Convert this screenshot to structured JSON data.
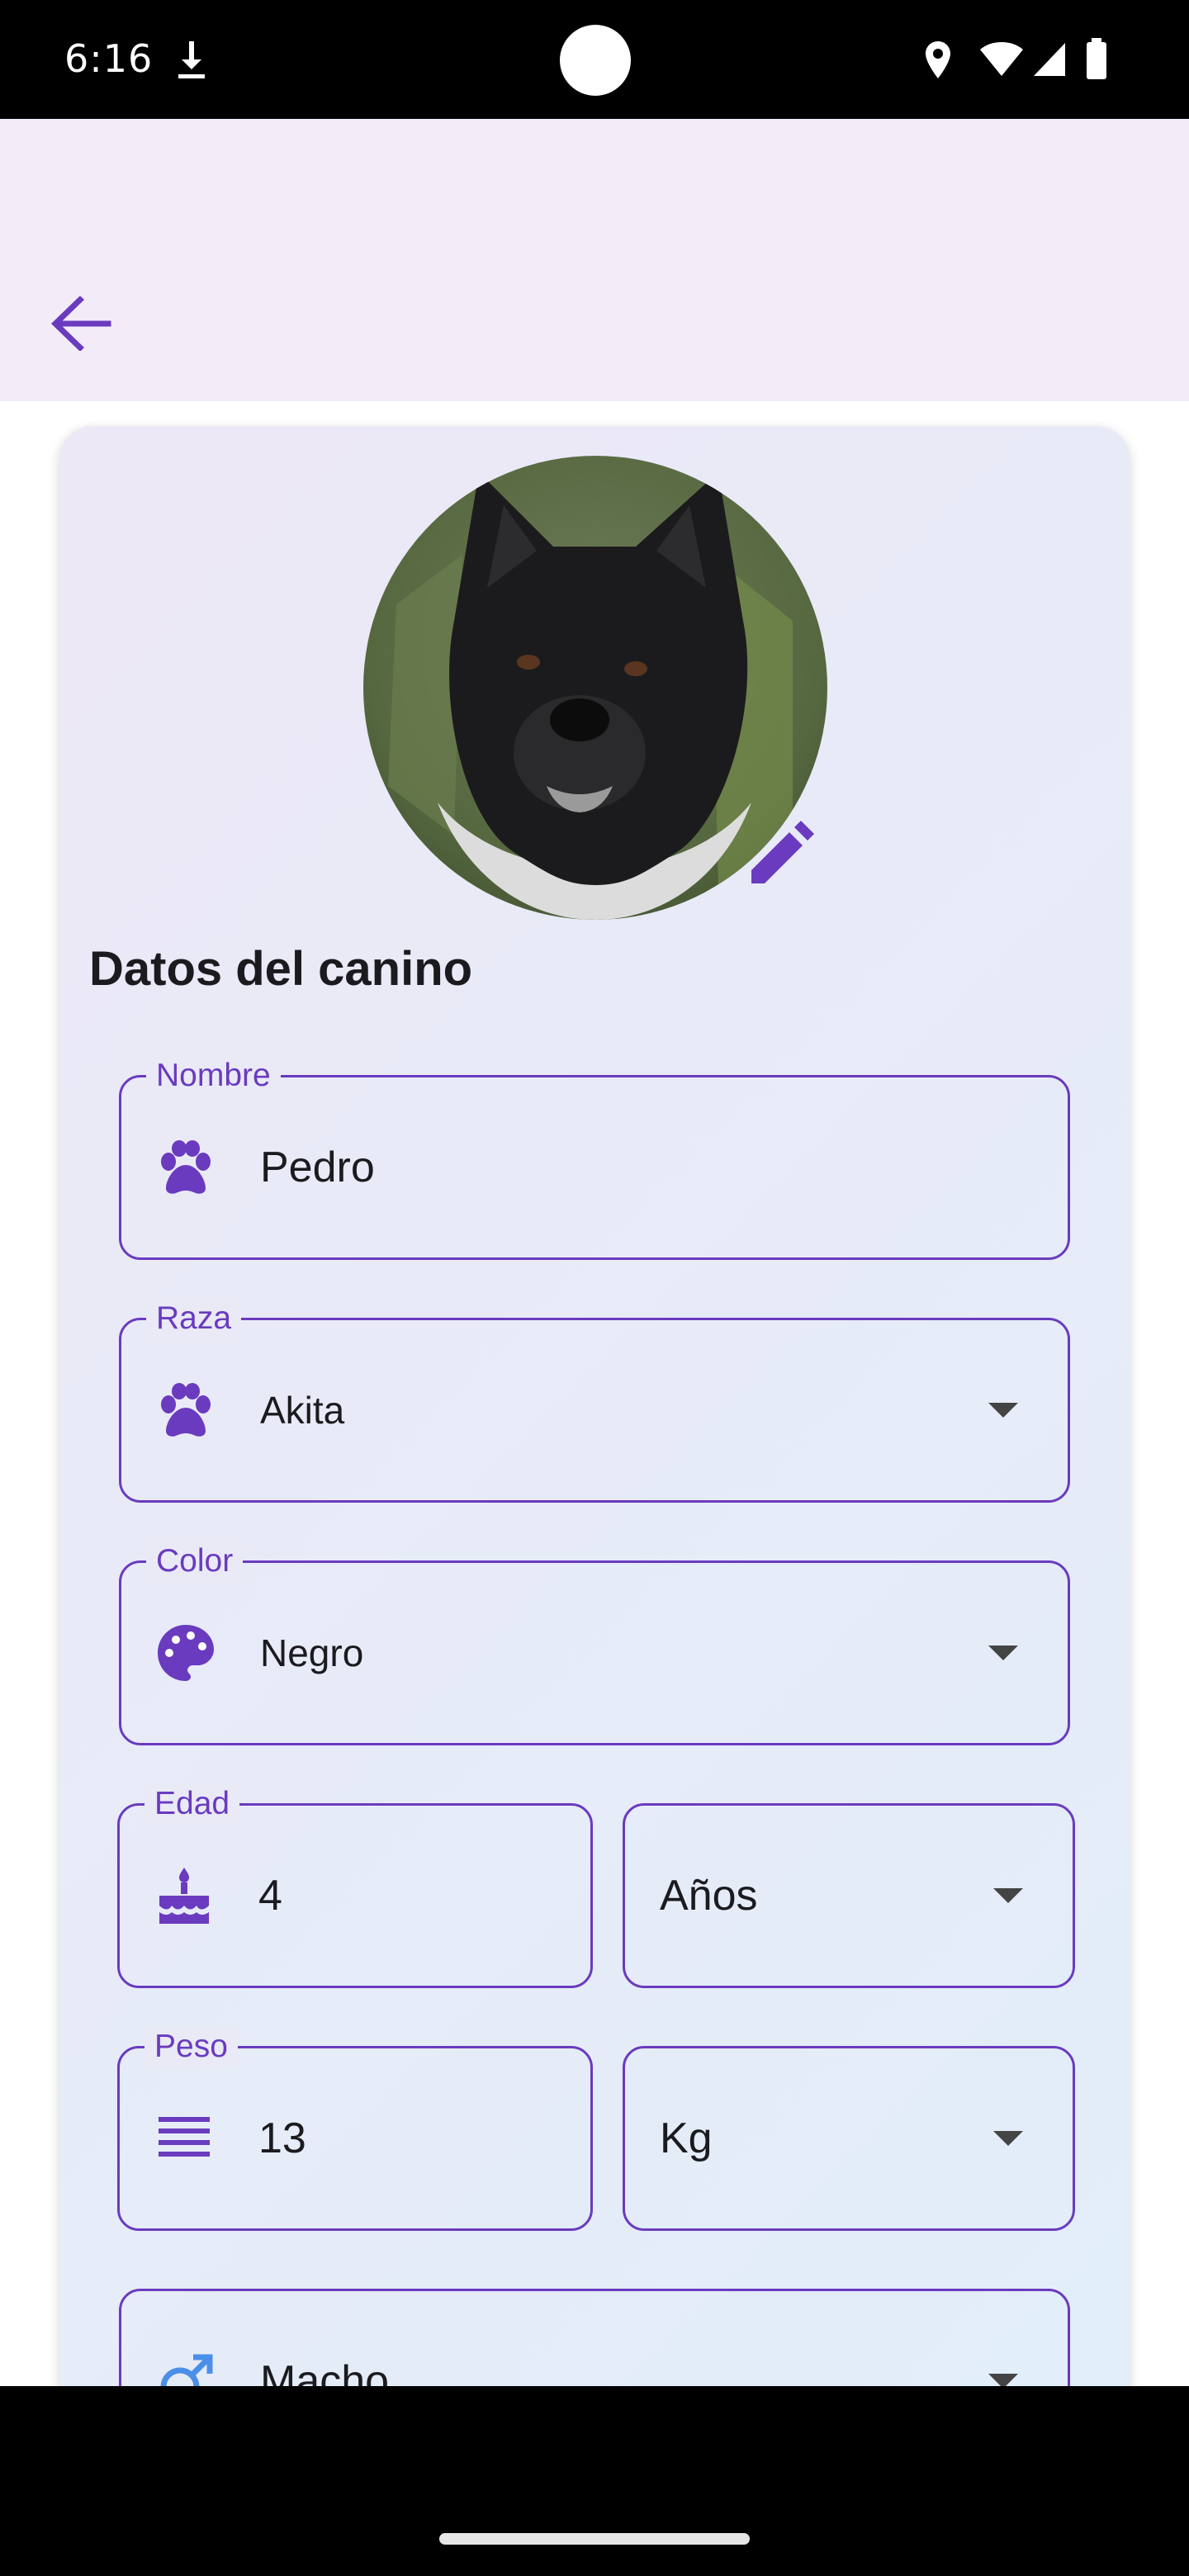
{
  "status_bar": {
    "time": "6:16",
    "icons": [
      "download-icon",
      "location-icon",
      "wifi-icon",
      "signal-icon",
      "battery-icon"
    ]
  },
  "app_bar": {
    "back_icon": "arrow-back-icon"
  },
  "profile": {
    "photo": "dog-photo",
    "edit_icon": "pencil-icon"
  },
  "section_title": "Datos del canino",
  "fields": {
    "nombre": {
      "label": "Nombre",
      "value": "Pedro",
      "icon": "paw-icon"
    },
    "raza": {
      "label": "Raza",
      "value": "Akita",
      "icon": "paw-icon"
    },
    "color": {
      "label": "Color",
      "value": "Negro",
      "icon": "palette-icon"
    },
    "edad": {
      "label": "Edad",
      "value": "4",
      "icon": "cake-icon",
      "unit": "Años"
    },
    "peso": {
      "label": "Peso",
      "value": "13",
      "icon": "weight-lines-icon",
      "unit": "Kg"
    },
    "sexo": {
      "value": "Macho",
      "icon": "male-icon"
    }
  },
  "colors": {
    "accent": "#6a3bbf",
    "app_bar_bg": "#f1ecf7",
    "male_icon": "#4a8fe8"
  }
}
